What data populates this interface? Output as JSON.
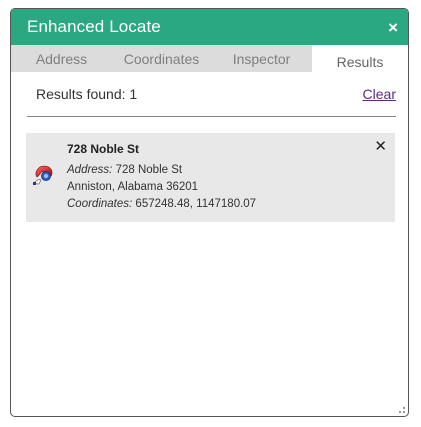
{
  "widget": {
    "title": "Enhanced Locate",
    "close_glyph": "×"
  },
  "tabs": [
    {
      "label": "Address",
      "active": false
    },
    {
      "label": "Coordinates",
      "active": false
    },
    {
      "label": "Inspector",
      "active": false
    },
    {
      "label": "Results",
      "active": true
    }
  ],
  "results": {
    "count_text": "Results found: 1",
    "clear_label": "Clear",
    "items": [
      {
        "title": "728 Noble St",
        "address_label": "Address:",
        "address_line1": "728 Noble St",
        "address_line2": "Anniston, Alabama 36201",
        "coords_label": "Coordinates:",
        "coords_value": "657248.48, 1147180.07",
        "remove_glyph": "✕",
        "icon": "zoom-to-location-icon"
      }
    ]
  },
  "colors": {
    "header": "#2aa881",
    "tab_inactive": "#dcdcdc",
    "result_bg": "#e8e8e8",
    "link": "#5b2a86"
  }
}
